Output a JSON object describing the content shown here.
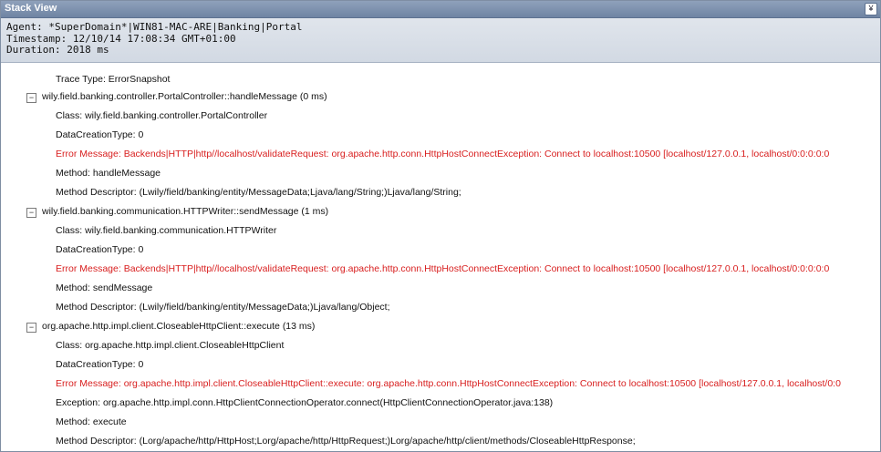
{
  "panel": {
    "title": "Stack View",
    "collapse_glyph": "¥"
  },
  "info": {
    "agent": "Agent: *SuperDomain*|WIN81-MAC-ARE|Banking|Portal",
    "timestamp": "Timestamp: 12/10/14 17:08:34 GMT+01:00",
    "duration": "Duration: 2018 ms"
  },
  "tree": {
    "trace_type": "Trace Type: ErrorSnapshot",
    "toggle_glyph": "−",
    "nodes": [
      {
        "label": "wily.field.banking.controller.PortalController::handleMessage (0 ms)",
        "class": "Class: wily.field.banking.controller.PortalController",
        "data_creation": "DataCreationType: 0",
        "error": "Error Message: Backends|HTTP|http//localhost/validateRequest: org.apache.http.conn.HttpHostConnectException: Connect to localhost:10500 [localhost/127.0.0.1, localhost/0:0:0:0:0",
        "method": "Method: handleMessage",
        "descriptor": "Method Descriptor: (Lwily/field/banking/entity/MessageData;Ljava/lang/String;)Ljava/lang/String;"
      },
      {
        "label": "wily.field.banking.communication.HTTPWriter::sendMessage (1 ms)",
        "class": "Class: wily.field.banking.communication.HTTPWriter",
        "data_creation": "DataCreationType: 0",
        "error": "Error Message: Backends|HTTP|http//localhost/validateRequest: org.apache.http.conn.HttpHostConnectException: Connect to localhost:10500 [localhost/127.0.0.1, localhost/0:0:0:0:0",
        "method": "Method: sendMessage",
        "descriptor": "Method Descriptor: (Lwily/field/banking/entity/MessageData;)Ljava/lang/Object;"
      },
      {
        "label": "org.apache.http.impl.client.CloseableHttpClient::execute (13 ms)",
        "class": "Class: org.apache.http.impl.client.CloseableHttpClient",
        "data_creation": "DataCreationType: 0",
        "error": "Error Message: org.apache.http.impl.client.CloseableHttpClient::execute: org.apache.http.conn.HttpHostConnectException: Connect to localhost:10500 [localhost/127.0.0.1, localhost/0:0",
        "exception": "Exception: org.apache.http.impl.conn.HttpClientConnectionOperator.connect(HttpClientConnectionOperator.java:138)",
        "method": "Method: execute",
        "descriptor": "Method Descriptor: (Lorg/apache/http/HttpHost;Lorg/apache/http/HttpRequest;)Lorg/apache/http/client/methods/CloseableHttpResponse;"
      }
    ]
  }
}
